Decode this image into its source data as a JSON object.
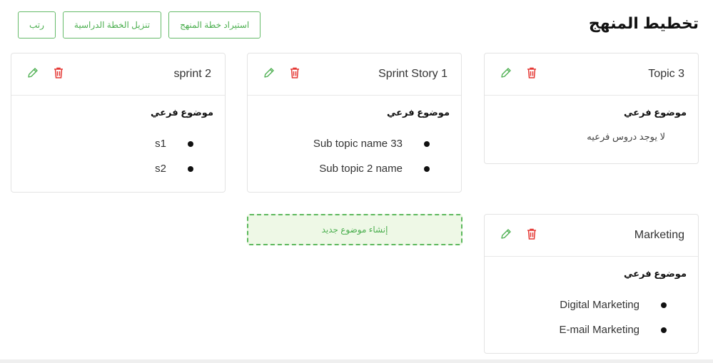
{
  "page": {
    "title": "تخطيط المنهج"
  },
  "actions": {
    "arrange": "رتب",
    "download_plan": "تنزيل الخطة الدراسية",
    "import_plan": "استيراد خطة المنهج"
  },
  "labels": {
    "subtopic_heading": "موضوع فرعي",
    "no_lessons": "لا يوجد دروس فرعيه",
    "create_topic": "إنشاء موضوع جديد"
  },
  "topics": [
    {
      "title": "Topic 3",
      "subtopics": []
    },
    {
      "title": "Sprint Story 1",
      "subtopics": [
        "Sub topic name 33",
        "Sub topic 2 name"
      ]
    },
    {
      "title": "sprint 2",
      "subtopics": [
        "s1",
        "s2"
      ]
    },
    {
      "title": "Marketing",
      "subtopics": [
        "Digital Marketing",
        "E-mail Marketing"
      ]
    }
  ],
  "icons": {
    "delete": "trash-icon",
    "edit": "pencil-icon"
  },
  "colors": {
    "accent": "#4caf50",
    "delete": "#e53935",
    "dashed_bg": "#eef8e6"
  }
}
